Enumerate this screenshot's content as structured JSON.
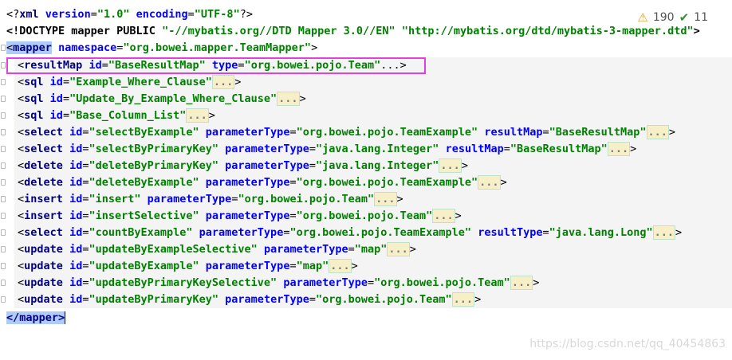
{
  "lines": {
    "xml_decl": {
      "open": "<?",
      "name": "xml",
      "a1": "version",
      "v1": "\"1.0\"",
      "a2": "encoding",
      "v2": "\"UTF-8\"",
      "close": "?>"
    },
    "doctype": {
      "text": "<!DOCTYPE mapper PUBLIC ",
      "v1": "\"-//mybatis.org//DTD Mapper 3.0//EN\"",
      "v2": "\"http://mybatis.org/dtd/mybatis-3-mapper.dtd\"",
      "close": ">"
    },
    "mapper_open": {
      "lt": "<",
      "tag": "mapper",
      "attr": "namespace",
      "val": "\"org.bowei.mapper.TeamMapper\"",
      "gt": ">"
    },
    "items": [
      {
        "tag": "resultMap",
        "attrs": [
          [
            "id",
            "\"BaseResultMap\""
          ],
          [
            "type",
            "\"org.bowei.pojo.Team\""
          ]
        ],
        "fold": "...",
        "plain_fold": true
      },
      {
        "tag": "sql",
        "attrs": [
          [
            "id",
            "\"Example_Where_Clause\""
          ]
        ],
        "fold": "..."
      },
      {
        "tag": "sql",
        "attrs": [
          [
            "id",
            "\"Update_By_Example_Where_Clause\""
          ]
        ],
        "fold": "..."
      },
      {
        "tag": "sql",
        "attrs": [
          [
            "id",
            "\"Base_Column_List\""
          ]
        ],
        "fold": "..."
      },
      {
        "tag": "select",
        "attrs": [
          [
            "id",
            "\"selectByExample\""
          ],
          [
            "parameterType",
            "\"org.bowei.pojo.TeamExample\""
          ],
          [
            "resultMap",
            "\"BaseResultMap\""
          ]
        ],
        "fold": "..."
      },
      {
        "tag": "select",
        "attrs": [
          [
            "id",
            "\"selectByPrimaryKey\""
          ],
          [
            "parameterType",
            "\"java.lang.Integer\""
          ],
          [
            "resultMap",
            "\"BaseResultMap\""
          ]
        ],
        "fold": "..."
      },
      {
        "tag": "delete",
        "attrs": [
          [
            "id",
            "\"deleteByPrimaryKey\""
          ],
          [
            "parameterType",
            "\"java.lang.Integer\""
          ]
        ],
        "fold": "..."
      },
      {
        "tag": "delete",
        "attrs": [
          [
            "id",
            "\"deleteByExample\""
          ],
          [
            "parameterType",
            "\"org.bowei.pojo.TeamExample\""
          ]
        ],
        "fold": "..."
      },
      {
        "tag": "insert",
        "attrs": [
          [
            "id",
            "\"insert\""
          ],
          [
            "parameterType",
            "\"org.bowei.pojo.Team\""
          ]
        ],
        "fold": "..."
      },
      {
        "tag": "insert",
        "attrs": [
          [
            "id",
            "\"insertSelective\""
          ],
          [
            "parameterType",
            "\"org.bowei.pojo.Team\""
          ]
        ],
        "fold": "..."
      },
      {
        "tag": "select",
        "attrs": [
          [
            "id",
            "\"countByExample\""
          ],
          [
            "parameterType",
            "\"org.bowei.pojo.TeamExample\""
          ],
          [
            "resultType",
            "\"java.lang.Long\""
          ]
        ],
        "fold": "..."
      },
      {
        "tag": "update",
        "attrs": [
          [
            "id",
            "\"updateByExampleSelective\""
          ],
          [
            "parameterType",
            "\"map\""
          ]
        ],
        "fold": "..."
      },
      {
        "tag": "update",
        "attrs": [
          [
            "id",
            "\"updateByExample\""
          ],
          [
            "parameterType",
            "\"map\""
          ]
        ],
        "fold": "..."
      },
      {
        "tag": "update",
        "attrs": [
          [
            "id",
            "\"updateByPrimaryKeySelective\""
          ],
          [
            "parameterType",
            "\"org.bowei.pojo.Team\""
          ]
        ],
        "fold": "..."
      },
      {
        "tag": "update",
        "attrs": [
          [
            "id",
            "\"updateByPrimaryKey\""
          ],
          [
            "parameterType",
            "\"org.bowei.pojo.Team\""
          ]
        ],
        "fold": "..."
      }
    ],
    "mapper_close": {
      "text": "</mapper>"
    }
  },
  "status": {
    "warnings": "190",
    "ok": "11",
    "warn_icon": "warning-icon",
    "ok_icon": "check-icon"
  },
  "watermark": "https://blog.csdn.net/qq_40454863",
  "colors": {
    "tag": "#000080",
    "attr": "#0000ff",
    "value": "#008000",
    "highlight_box": "#e040e0"
  }
}
